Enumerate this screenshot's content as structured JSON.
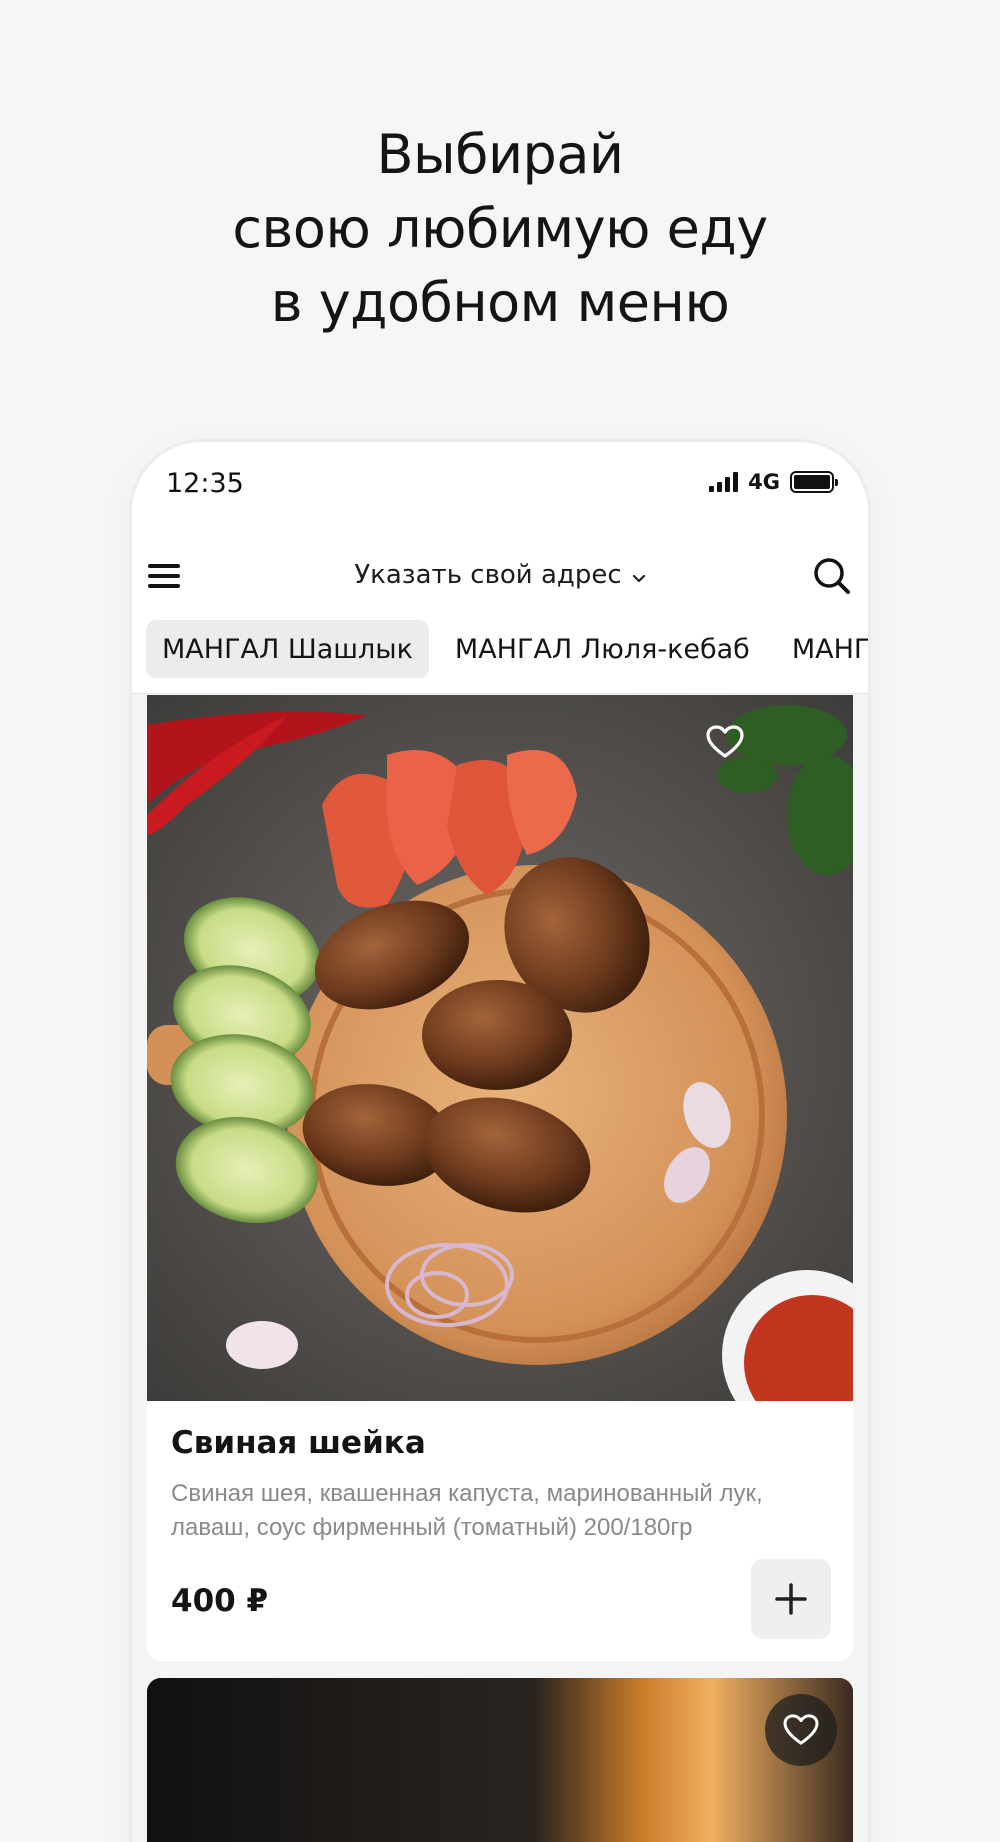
{
  "headline": {
    "line1": "Выбирай",
    "line2": "свою любимую еду",
    "line3": "в удобном меню"
  },
  "status_bar": {
    "time": "12:35",
    "network": "4G"
  },
  "app_bar": {
    "menu_icon": "hamburger-icon",
    "address_label": "Указать свой адрес",
    "search_icon": "search-icon"
  },
  "category_tabs": [
    {
      "label": "МАНГАЛ Шашлык",
      "active": true
    },
    {
      "label": "МАНГАЛ Люля-кебаб",
      "active": false
    },
    {
      "label": "МАНГАЛ Ку",
      "active": false
    }
  ],
  "products": [
    {
      "name": "Свиная шейка",
      "description": "Свиная шея, квашенная капуста, маринованный лук, лаваш, соус фирменный (томатный) 200/180гр",
      "price": "400 ₽",
      "favorite_icon": "heart-icon",
      "add_icon": "plus-icon"
    },
    {
      "favorite_icon": "heart-icon"
    }
  ],
  "colors": {
    "background": "#f6f6f6",
    "surface": "#ffffff",
    "chip": "#ececec",
    "text": "#141414",
    "muted": "#8a8a8a"
  }
}
